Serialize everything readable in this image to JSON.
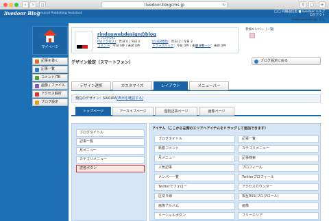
{
  "browser": {
    "url": "livedoor.blogcms.jp"
  },
  "header": {
    "logo": "livedoor Blog",
    "tagline": "Personal Publishing Assistant",
    "links_line1": "◯◯ 同報返信案 ■ livedoor ヘルプ",
    "links_line2": "ログアウト",
    "user": "rindouwebdesign さん"
  },
  "sidebar": {
    "mypage": "マイページ",
    "items": [
      {
        "label": "記事を書く",
        "color": "#e86b1c"
      },
      {
        "label": "記事一覧",
        "color": "#2f7bd1"
      },
      {
        "label": "コメント/TB",
        "color": "#48a43c"
      },
      {
        "label": "画像 / ファイル",
        "color": "#7a5cc0"
      },
      {
        "label": "アクセス解析",
        "color": "#d6342b"
      },
      {
        "label": "ブログ設定",
        "color": "#e0a118"
      }
    ]
  },
  "blog": {
    "title": "rindouwebdesignのblog",
    "url_label": "ブログURL",
    "pv_label": "PV(アクセス)",
    "pv_value": "：昨日 0 / 今日 0",
    "uu_label": "UU(訪問者)",
    "uu_value": "：昨日 2 / 今日 2",
    "comment_label": "コメント",
    "comment_value": "：今日 0件 / 未読 0件",
    "tb_label": "トラックバック",
    "tb_value": "：今日 0件 / 未読 0件",
    "msg_label": "メッセージ",
    "msg_value": "：未読 0件"
  },
  "members": {
    "label": "参加メンバー（",
    "link": "一覧",
    "close": "）"
  },
  "design": {
    "title": "デザイン設定（スマートフォン）",
    "back_button": "ブログ設定に戻る"
  },
  "tabs": [
    "デザイン選択",
    "カスタマイズ",
    "レイアウト",
    "メニューバー"
  ],
  "current_design": {
    "prefix": "現在のデザイン：SAKURA",
    "link": "[表示を確認する]"
  },
  "subtabs": [
    "トップページ",
    "アーカイブページ",
    "個別記事ページ",
    "画像ページ"
  ],
  "left_items": [
    "ブログタイトル",
    "記事一覧",
    "月メニュー",
    "カテゴリメニュー",
    "読者ボタン"
  ],
  "right_title": "アイテム（ここから左側のエリアへアイテムをドラッグして追加できます）",
  "right_items_left": [
    "ブログタイトル",
    "新着コメント",
    "月メニュー",
    "人気記事",
    "メンバー一覧",
    "Twitterでフォロー",
    "区切り線",
    "画像アルバム",
    "ソーシャルボタン"
  ],
  "right_items_right": [
    "記事一覧",
    "カテゴリメニュー",
    "記事検索",
    "プロフィール",
    "Twitterプロフィール",
    "アクセスカウンター",
    "相互RSS(ブログロール)",
    "画像",
    "フリーエリア"
  ]
}
